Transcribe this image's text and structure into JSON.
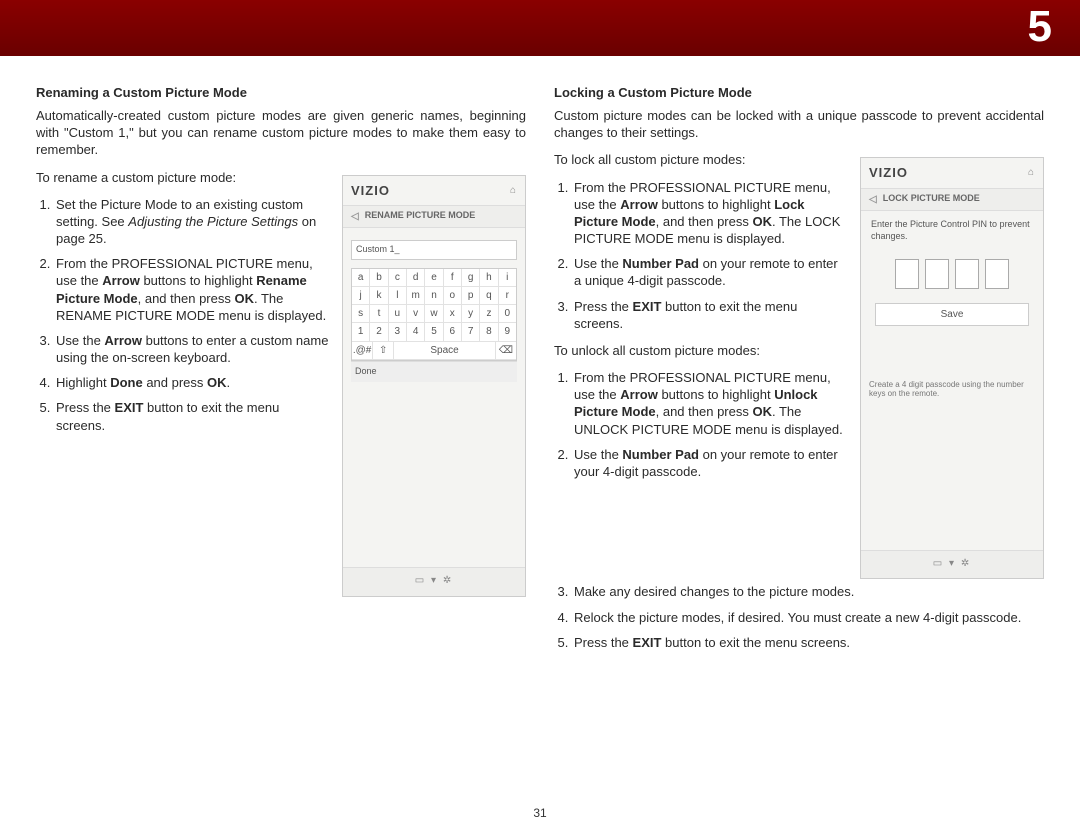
{
  "chapter_number": "5",
  "page_number": "31",
  "left": {
    "heading": "Renaming a Custom Picture Mode",
    "intro": "Automatically-created custom picture modes are given generic names, beginning with \"Custom 1,\" but you can rename custom picture modes to make them easy to remember.",
    "lead": "To rename a custom picture mode:",
    "steps": {
      "s1a": "Set the Picture Mode to an existing custom setting. See ",
      "s1b": "Adjusting the Picture Settings",
      "s1c": " on page 25.",
      "s2a": "From the PROFESSIONAL PICTURE menu, use the ",
      "s2b": "Arrow",
      "s2c": " buttons to highlight ",
      "s2d": "Rename Picture Mode",
      "s2e": ", and then press ",
      "s2f": "OK",
      "s2g": ". The RENAME PICTURE MODE menu is displayed.",
      "s3a": "Use the ",
      "s3b": "Arrow",
      "s3c": " buttons to enter a custom name using the on‑screen keyboard.",
      "s4a": "Highlight ",
      "s4b": "Done",
      "s4c": " and press ",
      "s4d": "OK",
      "s4e": ".",
      "s5a": "Press the ",
      "s5b": "EXIT",
      "s5c": " button to exit the menu screens."
    },
    "mock": {
      "brand": "VIZIO",
      "title": "RENAME PICTURE MODE",
      "input_value": "Custom 1_",
      "rows": [
        [
          "a",
          "b",
          "c",
          "d",
          "e",
          "f",
          "g",
          "h",
          "i"
        ],
        [
          "j",
          "k",
          "l",
          "m",
          "n",
          "o",
          "p",
          "q",
          "r"
        ],
        [
          "s",
          "t",
          "u",
          "v",
          "w",
          "x",
          "y",
          "z",
          "0"
        ],
        [
          "1",
          "2",
          "3",
          "4",
          "5",
          "6",
          "7",
          "8",
          "9"
        ]
      ],
      "sym_key": ".@#",
      "shift_key": "⇧",
      "space_key": "Space",
      "bksp_key": "⌫",
      "done": "Done",
      "footer": "▭  ▾  ✲"
    }
  },
  "right": {
    "heading": "Locking a Custom Picture Mode",
    "intro": "Custom picture modes can be locked with a unique passcode to prevent accidental changes to their settings.",
    "lead_lock": "To lock all custom picture modes:",
    "lock_steps": {
      "s1a": "From the PROFESSIONAL PICTURE menu, use the ",
      "s1b": "Arrow",
      "s1c": " buttons to highlight ",
      "s1d": "Lock Picture Mode",
      "s1e": ", and then press ",
      "s1f": "OK",
      "s1g": ". The LOCK PICTURE MODE menu is displayed.",
      "s2a": "Use the ",
      "s2b": "Number Pad",
      "s2c": " on your remote to enter a unique 4‑digit passcode.",
      "s3a": "Press the ",
      "s3b": "EXIT",
      "s3c": " button to exit the menu screens."
    },
    "lead_unlock": "To unlock all custom picture modes:",
    "unlock_steps": {
      "s1a": "From the PROFESSIONAL PICTURE menu, use the ",
      "s1b": "Arrow",
      "s1c": " buttons to highlight ",
      "s1d": "Unlock Picture Mode",
      "s1e": ", and then press ",
      "s1f": "OK",
      "s1g": ". The UNLOCK PICTURE MODE menu is displayed.",
      "s2a": "Use the ",
      "s2b": "Number Pad",
      "s2c": " on your remote to enter your 4‑digit passcode.",
      "s3": "Make any desired changes to the picture modes.",
      "s4": "Relock the picture modes, if desired. You must create a new 4‑digit passcode.",
      "s5a": "Press the ",
      "s5b": "EXIT",
      "s5c": " button to exit the menu screens."
    },
    "mock": {
      "brand": "VIZIO",
      "title": "LOCK PICTURE MODE",
      "instr": "Enter the Picture Control PIN to prevent changes.",
      "save": "Save",
      "hint": "Create a 4 digit passcode using the number keys on the remote.",
      "footer": "▭  ▾  ✲"
    }
  }
}
